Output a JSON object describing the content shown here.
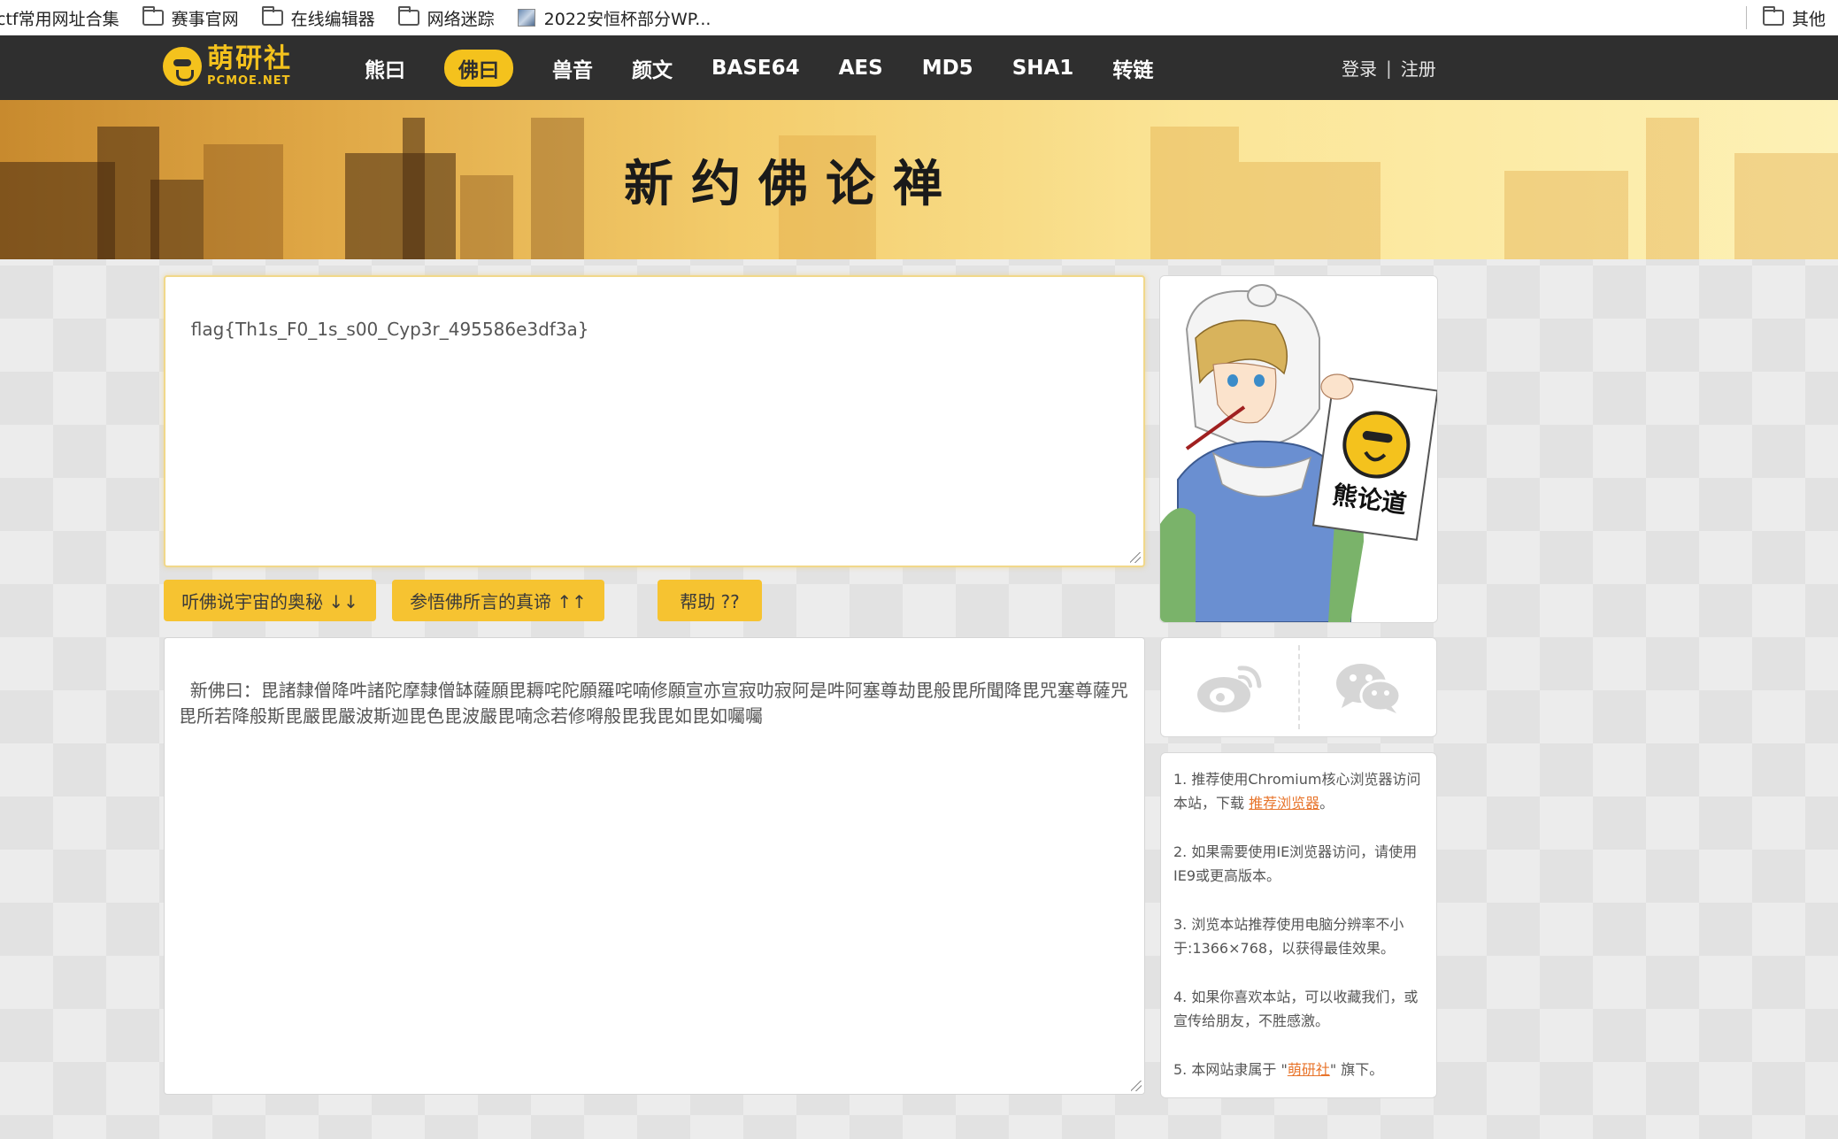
{
  "bookmarks": {
    "items": [
      {
        "label": "ctf常用网址合集",
        "icon": "none"
      },
      {
        "label": "赛事官网",
        "icon": "folder-icon"
      },
      {
        "label": "在线编辑器",
        "icon": "folder-icon"
      },
      {
        "label": "网络迷踪",
        "icon": "folder-icon"
      },
      {
        "label": "2022安恒杯部分WP...",
        "icon": "page-favicon"
      }
    ],
    "other": "其他"
  },
  "nav": {
    "logo_cn": "萌研社",
    "logo_en": "PCMOE.NET",
    "items": [
      "熊曰",
      "佛曰",
      "兽音",
      "颜文",
      "BASE64",
      "AES",
      "MD5",
      "SHA1",
      "转链"
    ],
    "active_index": 1,
    "login": "登录",
    "divider": "|",
    "register": "注册"
  },
  "banner": {
    "title": "新约佛论禅"
  },
  "input": {
    "value": "flag{Th1s_F0_1s_s00_Cyp3r_495586e3df3a}"
  },
  "buttons": {
    "encode": "听佛说宇宙的奥秘 ↓↓",
    "decode": "参悟佛所言的真谛 ↑↑",
    "help": "帮助 ??"
  },
  "output": {
    "value": "新佛曰：毘諸隸僧降吽諸陀摩隸僧缽薩願毘耨咤陀願羅咤喃修願宣亦宣寂叻寂阿是吽阿塞尊劫毘般毘所聞降毘咒塞尊薩咒毘所若降般斯毘嚴毘嚴波斯迦毘色毘波嚴毘喃念若修嘚般毘我毘如毘如囑囑"
  },
  "sidebar": {
    "art_sign": "熊论道",
    "social": [
      "weibo-icon",
      "wechat-icon"
    ],
    "notes": [
      {
        "text": "1. 推荐使用Chromium核心浏览器访问本站，下载 ",
        "link": "推荐浏览器",
        "tail": "。"
      },
      {
        "text": "2. 如果需要使用IE浏览器访问，请使用IE9或更高版本。",
        "link": "",
        "tail": ""
      },
      {
        "text": "3. 浏览本站推荐使用电脑分辨率不小于:1366×768，以获得最佳效果。",
        "link": "",
        "tail": ""
      },
      {
        "text": "4. 如果你喜欢本站，可以收藏我们，或宣传给朋友，不胜感激。",
        "link": "",
        "tail": ""
      },
      {
        "text": "5. 本网站隶属于 \"",
        "link": "萌研社",
        "tail": "\" 旗下。"
      }
    ]
  },
  "colors": {
    "accent": "#f6c331",
    "nav_bg": "#2f2f2f",
    "link": "#e8752c"
  }
}
